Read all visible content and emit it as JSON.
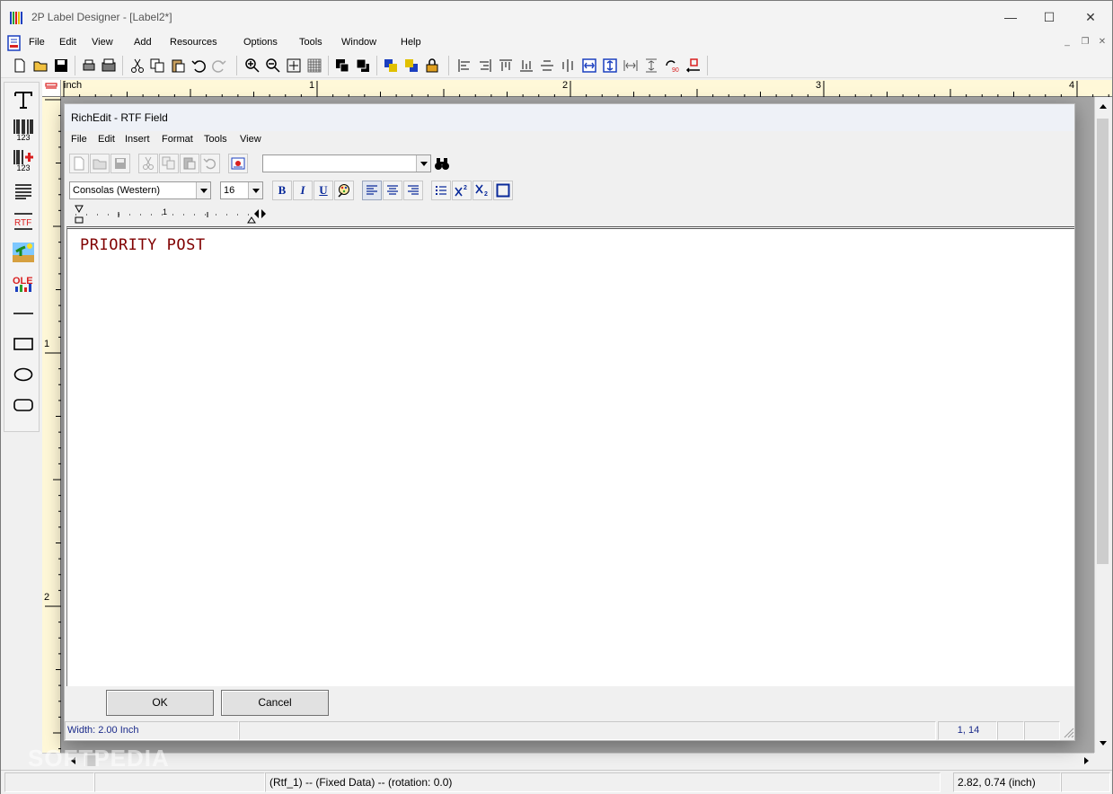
{
  "window": {
    "title": "2P Label Designer - [Label2*]",
    "minimize": "—",
    "maximize": "☐",
    "close": "✕"
  },
  "menu": {
    "items": [
      "File",
      "Edit",
      "View",
      "Add",
      "Resources",
      "Options",
      "Tools",
      "Window",
      "Help"
    ],
    "mdi_minimize": "_",
    "mdi_restore": "❐",
    "mdi_close": "✕"
  },
  "ruler": {
    "unit": "inch",
    "h_labels": [
      "1",
      "2",
      "3",
      "4"
    ],
    "v_labels": [
      "1",
      "2"
    ]
  },
  "left_tools": {
    "barcode_label": "123",
    "barcode2_label": "123",
    "rtf_label": "RTF",
    "ole_label": "OLE"
  },
  "dialog": {
    "title": "RichEdit - RTF Field",
    "menu": [
      "File",
      "Edit",
      "Insert",
      "Format",
      "Tools",
      "View"
    ],
    "search_value": "",
    "font_value": "Consolas (Western)",
    "size_value": "16",
    "bold_label": "B",
    "italic_label": "I",
    "underline_label": "U",
    "ruler_mark": "1",
    "editor_text": "PRIORITY POST",
    "ok_label": "OK",
    "cancel_label": "Cancel",
    "status_width": "Width: 2.00 Inch",
    "status_pos": "1, 14"
  },
  "status": {
    "field_info": "(Rtf_1) -- (Fixed Data) -- (rotation:  0.0)",
    "coords": "2.82, 0.74   (inch)"
  },
  "watermark": "SOFTPEDIA",
  "colors": {
    "editor_text": "#800000",
    "ruler_bg": "#fff8d8",
    "workspace_bg": "#a5a5a5"
  }
}
